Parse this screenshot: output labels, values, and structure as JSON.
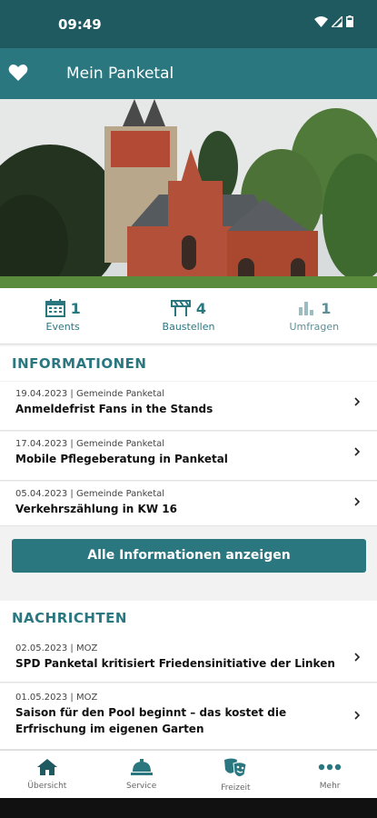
{
  "status_bar": {
    "time": "09:49"
  },
  "app_bar": {
    "title": "Mein Panketal",
    "icon": "heart-icon"
  },
  "stats": [
    {
      "count": "1",
      "label": "Events",
      "icon": "calendar-icon"
    },
    {
      "count": "4",
      "label": "Baustellen",
      "icon": "construction-icon"
    },
    {
      "count": "1",
      "label": "Umfragen",
      "icon": "poll-icon"
    }
  ],
  "informationen": {
    "title": "INFORMATIONEN",
    "items": [
      {
        "meta": "19.04.2023 | Gemeinde Panketal",
        "title": "Anmeldefrist Fans in the Stands"
      },
      {
        "meta": "17.04.2023 | Gemeinde Panketal",
        "title": "Mobile Pflegeberatung in Panketal"
      },
      {
        "meta": "05.04.2023 | Gemeinde Panketal",
        "title": "Verkehrszählung in KW 16"
      }
    ],
    "button_label": "Alle Informationen anzeigen"
  },
  "nachrichten": {
    "title": "NACHRICHTEN",
    "items": [
      {
        "meta": "02.05.2023 | MOZ",
        "title": "SPD Panketal kritisiert Friedensinitiative der Linken"
      },
      {
        "meta": "01.05.2023 | MOZ",
        "title": "Saison für den Pool beginnt – das kostet die Erfrischung im eigenen Garten"
      }
    ]
  },
  "bottom_nav": [
    {
      "label": "Übersicht",
      "icon": "home-icon"
    },
    {
      "label": "Service",
      "icon": "service-bell-icon"
    },
    {
      "label": "Freizeit",
      "icon": "theater-masks-icon"
    },
    {
      "label": "Mehr",
      "icon": "more-dots-icon"
    }
  ],
  "colors": {
    "primary": "#2a7780",
    "status_bar": "#1f5a61"
  }
}
